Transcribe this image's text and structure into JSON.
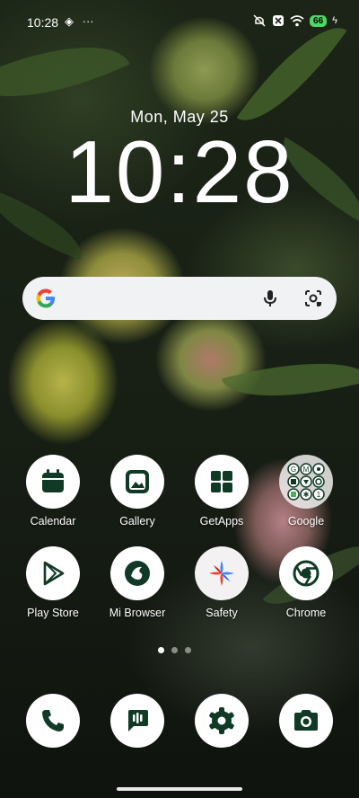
{
  "status_bar": {
    "time": "10:28",
    "battery": "66",
    "overflow": "···"
  },
  "lock": {
    "date": "Mon, May 25",
    "clock": "10:28"
  },
  "search_bar": {
    "logo": "google-g-icon",
    "mic": "mic-icon",
    "lens": "lens-icon"
  },
  "apps_row1": [
    {
      "label": "Calendar",
      "icon": "calendar-icon"
    },
    {
      "label": "Gallery",
      "icon": "gallery-icon"
    },
    {
      "label": "GetApps",
      "icon": "getapps-icon"
    },
    {
      "label": "Google",
      "icon": "folder-icon"
    }
  ],
  "apps_row2": [
    {
      "label": "Play Store",
      "icon": "play-store-icon"
    },
    {
      "label": "Mi Browser",
      "icon": "mi-browser-icon"
    },
    {
      "label": "Safety",
      "icon": "safety-icon"
    },
    {
      "label": "Chrome",
      "icon": "chrome-icon"
    }
  ],
  "dock": [
    {
      "icon": "phone-icon"
    },
    {
      "icon": "messages-icon"
    },
    {
      "icon": "settings-icon"
    },
    {
      "icon": "camera-icon"
    }
  ],
  "page_indicator": {
    "pages": 3,
    "active": 0
  },
  "colors": {
    "icon_dark": "#103a25",
    "battery": "#4cd964"
  }
}
